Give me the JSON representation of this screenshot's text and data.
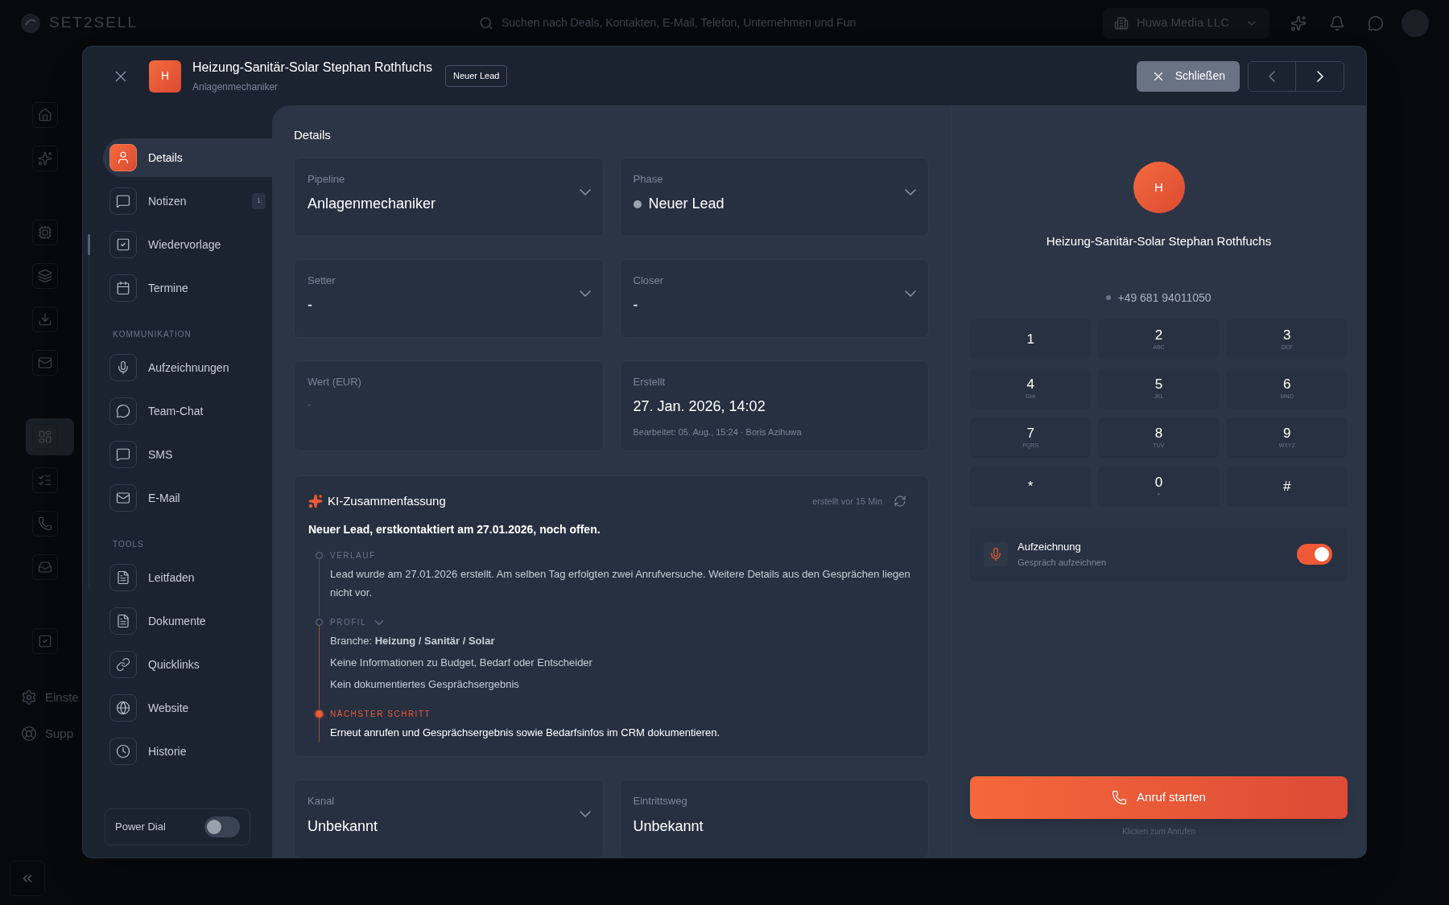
{
  "app": {
    "logo": "SET2SELL",
    "search": {
      "placeholder": "Suchen nach Deals, Kontakten, E-Mail, Telefon, Unternehmen und Fun"
    },
    "workspace": "Huwa Media LLC",
    "nav": [
      {
        "selected": false
      },
      {
        "selected": false
      },
      {
        "selected": false
      },
      {
        "selected": false
      },
      {
        "selected": false
      },
      {
        "selected": false
      },
      {
        "selected": true
      },
      {
        "selected": false
      },
      {
        "selected": false
      },
      {
        "selected": false
      },
      {
        "selected": false
      }
    ],
    "footer": [
      {
        "label": "Einste"
      },
      {
        "label": "Supp"
      }
    ]
  },
  "modal": {
    "avatar": "H",
    "title": "Heizung-Sanitär-Solar Stephan Rothfuchs",
    "subtitle": "Anlagenmechaniker",
    "badge": "Neuer Lead",
    "close_label": "Schließen"
  },
  "sidebar": {
    "sections": [
      {
        "items": [
          {
            "label": "Details",
            "selected": true
          },
          {
            "label": "Notizen",
            "selected": false,
            "count": "1"
          },
          {
            "label": "Wiedervorlage",
            "selected": false
          },
          {
            "label": "Termine",
            "selected": false
          }
        ]
      },
      {
        "title": "KOMMUNIKATION",
        "items": [
          {
            "label": "Aufzeichnungen",
            "selected": false
          },
          {
            "label": "Team-Chat",
            "selected": false
          },
          {
            "label": "SMS",
            "selected": false
          },
          {
            "label": "E-Mail",
            "selected": false
          }
        ]
      },
      {
        "title": "TOOLS",
        "items": [
          {
            "label": "Leitfaden",
            "selected": false
          },
          {
            "label": "Dokumente",
            "selected": false
          },
          {
            "label": "Quicklinks",
            "selected": false
          },
          {
            "label": "Website",
            "selected": false
          },
          {
            "label": "Historie",
            "selected": false
          }
        ]
      }
    ],
    "power_dial": {
      "label": "Power Dial",
      "on": false
    }
  },
  "details": {
    "title": "Details",
    "fields": [
      {
        "label": "Pipeline",
        "value": "Anlagenmechaniker",
        "dropdown": true
      },
      {
        "label": "Phase",
        "value": "Neuer Lead",
        "dropdown": true,
        "color": "#9ca3af"
      },
      {
        "label": "Setter",
        "value": "-",
        "dropdown": true
      },
      {
        "label": "Closer",
        "value": "-",
        "dropdown": true
      },
      {
        "label": "Wert (EUR)",
        "placeholder": "-",
        "dropdown": false
      },
      {
        "label": "Erstellt",
        "value": "27. Jan. 2026, 14:02",
        "dropdown": false,
        "note": "Bearbeitet: 05. Aug., 15:24 · Boris Azihuwa"
      }
    ],
    "summary": {
      "title": "KI-Zusammenfassung",
      "timestamp": "erstellt vor 15 Min",
      "headline": "Neuer Lead, erstkontaktiert am 27.01.2026, noch offen.",
      "sections": [
        {
          "title": "VERLAUF",
          "highlight": false,
          "lines": [
            "Lead wurde am 27.01.2026 erstellt. Am selben Tag erfolgten zwei Anrufversuche. Weitere Details aus den Gesprächen liegen nicht vor."
          ]
        },
        {
          "title": "PROFIL",
          "highlight": false,
          "expanded": true,
          "lines": [
            "Branche: **Heizung / Sanitär / Solar**",
            "Keine Informationen zu Budget, Bedarf oder Entscheider",
            "Kein dokumentiertes Gesprächsergebnis"
          ]
        },
        {
          "title": "NÄCHSTER SCHRITT",
          "highlight": true,
          "lines": [
            "Erneut anrufen und Gesprächsergebnis sowie Bedarfsinfos im CRM dokumentieren."
          ]
        }
      ]
    },
    "bottom_fields": [
      {
        "label": "Kanal",
        "value": "Unbekannt",
        "dropdown": true
      },
      {
        "label": "Eintrittsweg",
        "value": "Unbekannt",
        "dropdown": false
      }
    ]
  },
  "dialer": {
    "avatar": "H",
    "name": "Heizung-Sanitär-Solar Stephan Rothfuchs",
    "phone": "+49 681 94011050",
    "keys": [
      {
        "digit": "1"
      },
      {
        "digit": "2",
        "letters": "ABC"
      },
      {
        "digit": "3",
        "letters": "DEF"
      },
      {
        "digit": "4",
        "letters": "GHI"
      },
      {
        "digit": "5",
        "letters": "JKL"
      },
      {
        "digit": "6",
        "letters": "MNO"
      },
      {
        "digit": "7",
        "letters": "PQRS"
      },
      {
        "digit": "8",
        "letters": "TUV"
      },
      {
        "digit": "9",
        "letters": "WXYZ"
      },
      {
        "digit": "*"
      },
      {
        "digit": "0",
        "letters": "+"
      },
      {
        "digit": "#"
      }
    ],
    "recording": {
      "title": "Aufzeichnung",
      "subtitle": "Gespräch aufzeichnen",
      "on": true
    },
    "call_button": "Anruf starten",
    "hint": "Klicken zum Anrufen"
  }
}
